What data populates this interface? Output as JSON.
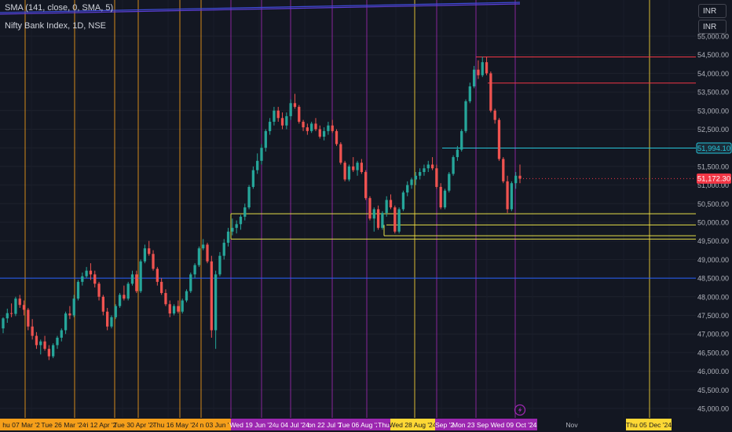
{
  "header": {
    "indicator": "SMA (141, close, 0, SMA, 5)",
    "symbol": "Nifty Bank Index, 1D, NSE"
  },
  "currency_buttons": [
    "INR",
    "INR"
  ],
  "price_labels": {
    "last_price": "51,172.30",
    "cross_line": "51,994.10"
  },
  "colors": {
    "background": "#131722",
    "bull": "#26a69a",
    "bear": "#ef5350",
    "orange_marker": "#f59f1a",
    "purple_marker": "#9c27b0",
    "yellow_marker": "#fdd835",
    "level_yellow": "#e6e04a",
    "level_red": "#f23645",
    "level_cyan": "#26c6da",
    "level_blue": "#2962ff"
  },
  "chart_data": {
    "type": "candlestick",
    "y_axis_ticks": [
      "55,000.00",
      "54,500.00",
      "54,000.00",
      "53,500.00",
      "53,000.00",
      "52,500.00",
      "52,000.00",
      "51,500.00",
      "51,000.00",
      "50,500.00",
      "50,000.00",
      "49,500.00",
      "49,000.00",
      "48,500.00",
      "48,000.00",
      "47,500.00",
      "47,000.00",
      "46,500.00",
      "46,000.00",
      "45,500.00",
      "45,000.00"
    ],
    "y_axis_values": [
      55000,
      54500,
      54000,
      53500,
      53000,
      52500,
      52000,
      51500,
      51000,
      50500,
      50000,
      49500,
      49000,
      48500,
      48000,
      47500,
      47000,
      46500,
      46000,
      45500,
      45000
    ],
    "ylim": [
      44900,
      55300
    ],
    "axis_side": "right",
    "time_labels": [
      {
        "text": "hu 07 Mar '2",
        "style": "orange"
      },
      {
        "text": "Tue 26 Mar '24",
        "style": "orange"
      },
      {
        "text": "ri 12 Apr '2",
        "style": "orange"
      },
      {
        "text": "Tue 30 Apr '24",
        "style": "orange"
      },
      {
        "text": "Thu 16 May '24",
        "style": "orange"
      },
      {
        "text": "n 03 Jun '",
        "style": "orange"
      },
      {
        "text": "Wed 19 Jun '24",
        "style": "purple"
      },
      {
        "text": "u 04 Jul '24",
        "style": "purple"
      },
      {
        "text": "on 22 Jul '2",
        "style": "purple"
      },
      {
        "text": "Tue 06 Aug '2",
        "style": "purple"
      },
      {
        "text": "Thu",
        "style": "purple"
      },
      {
        "text": "Wed 28 Aug '24",
        "style": "yellow"
      },
      {
        "text": "Sep '2",
        "style": "purple"
      },
      {
        "text": "Mon 23 Sep '",
        "style": "purple"
      },
      {
        "text": "Wed 09 Oct '24",
        "style": "purple"
      },
      {
        "text": "Nov",
        "style": "plain"
      },
      {
        "text": "Thu 05 Dec '24",
        "style": "yellow"
      }
    ],
    "vertical_markers": [
      {
        "color": "orange"
      },
      {
        "color": "orange"
      },
      {
        "color": "orange"
      },
      {
        "color": "orange"
      },
      {
        "color": "orange"
      },
      {
        "color": "orange"
      },
      {
        "color": "purple"
      },
      {
        "color": "purple"
      },
      {
        "color": "purple"
      },
      {
        "color": "purple"
      },
      {
        "color": "purple"
      },
      {
        "color": "yellow"
      },
      {
        "color": "purple"
      },
      {
        "color": "purple"
      },
      {
        "color": "purple"
      },
      {
        "color": "yellow"
      }
    ],
    "horizontal_levels": [
      {
        "price": 54440,
        "color": "red"
      },
      {
        "price": 53740,
        "color": "red"
      },
      {
        "price": 51994,
        "color": "cyan"
      },
      {
        "price": 50230,
        "color": "yellow"
      },
      {
        "price": 49930,
        "color": "yellow"
      },
      {
        "price": 49640,
        "color": "yellow"
      },
      {
        "price": 49550,
        "color": "yellow"
      },
      {
        "price": 48500,
        "color": "blue"
      }
    ],
    "last_price": 51172.3,
    "cross_line_price": 51994.1,
    "candles": [
      [
        47150,
        47450,
        47020,
        47420
      ],
      [
        47420,
        47680,
        47300,
        47560
      ],
      [
        47560,
        47820,
        47450,
        47540
      ],
      [
        47540,
        48000,
        47480,
        47950
      ],
      [
        47950,
        48050,
        47700,
        47780
      ],
      [
        47780,
        47900,
        47500,
        47650
      ],
      [
        47650,
        47700,
        47100,
        47200
      ],
      [
        47200,
        47400,
        46850,
        46950
      ],
      [
        46950,
        47050,
        46600,
        46700
      ],
      [
        46700,
        46850,
        46450,
        46800
      ],
      [
        46800,
        46950,
        46550,
        46600
      ],
      [
        46600,
        46700,
        46300,
        46400
      ],
      [
        46400,
        46750,
        46350,
        46700
      ],
      [
        46700,
        46950,
        46600,
        46900
      ],
      [
        46900,
        47150,
        46800,
        47100
      ],
      [
        47100,
        47600,
        47000,
        47550
      ],
      [
        47550,
        47750,
        47400,
        47500
      ],
      [
        47500,
        48050,
        47450,
        47950
      ],
      [
        47950,
        48450,
        47900,
        48400
      ],
      [
        48400,
        48650,
        48300,
        48550
      ],
      [
        48550,
        48800,
        48500,
        48700
      ],
      [
        48700,
        48900,
        48450,
        48600
      ],
      [
        48600,
        48700,
        48250,
        48350
      ],
      [
        48350,
        48400,
        47900,
        48000
      ],
      [
        48000,
        48050,
        47500,
        47600
      ],
      [
        47600,
        47700,
        47100,
        47200
      ],
      [
        47200,
        47500,
        47150,
        47450
      ],
      [
        47450,
        47800,
        47400,
        47750
      ],
      [
        47750,
        48100,
        47700,
        48050
      ],
      [
        48050,
        48300,
        47900,
        47950
      ],
      [
        47950,
        48400,
        47900,
        48350
      ],
      [
        48350,
        48700,
        48300,
        48600
      ],
      [
        48600,
        48700,
        48100,
        48150
      ],
      [
        48150,
        49000,
        48100,
        48950
      ],
      [
        48950,
        49400,
        48900,
        49300
      ],
      [
        49300,
        49500,
        49100,
        49150
      ],
      [
        49150,
        49250,
        48700,
        48750
      ],
      [
        48750,
        48800,
        48300,
        48400
      ],
      [
        48400,
        48500,
        48050,
        48100
      ],
      [
        48100,
        48200,
        47750,
        47800
      ],
      [
        47800,
        47900,
        47450,
        47550
      ],
      [
        47550,
        47800,
        47500,
        47750
      ],
      [
        47750,
        47900,
        47550,
        47600
      ],
      [
        47600,
        47950,
        47550,
        47900
      ],
      [
        47900,
        48200,
        47850,
        48150
      ],
      [
        48150,
        48650,
        48100,
        48600
      ],
      [
        48600,
        48900,
        48500,
        48850
      ],
      [
        48850,
        49350,
        48800,
        49300
      ],
      [
        49300,
        49550,
        49250,
        49400
      ],
      [
        49400,
        49450,
        48900,
        48950
      ],
      [
        48950,
        49100,
        46900,
        47100
      ],
      [
        47100,
        48700,
        46600,
        48600
      ],
      [
        48600,
        49200,
        48550,
        49100
      ],
      [
        49100,
        49550,
        49000,
        49450
      ],
      [
        49450,
        49850,
        49350,
        49750
      ],
      [
        49750,
        50100,
        49650,
        49850
      ],
      [
        49850,
        50050,
        49700,
        49950
      ],
      [
        49950,
        50200,
        49800,
        50150
      ],
      [
        50150,
        50500,
        50050,
        50400
      ],
      [
        50400,
        51000,
        50350,
        50950
      ],
      [
        50950,
        51500,
        50900,
        51400
      ],
      [
        51400,
        51850,
        51300,
        51650
      ],
      [
        51650,
        52100,
        51550,
        52000
      ],
      [
        52000,
        52500,
        51900,
        52450
      ],
      [
        52450,
        52800,
        52350,
        52700
      ],
      [
        52700,
        53100,
        52600,
        53000
      ],
      [
        53000,
        53100,
        52700,
        52800
      ],
      [
        52800,
        52950,
        52500,
        52600
      ],
      [
        52600,
        52950,
        52500,
        52850
      ],
      [
        52850,
        53300,
        52750,
        53200
      ],
      [
        53200,
        53450,
        53050,
        53100
      ],
      [
        53100,
        53150,
        52650,
        52700
      ],
      [
        52700,
        52750,
        52450,
        52550
      ],
      [
        52550,
        52650,
        52350,
        52450
      ],
      [
        52450,
        52700,
        52400,
        52650
      ],
      [
        52650,
        52800,
        52450,
        52500
      ],
      [
        52500,
        52600,
        52250,
        52300
      ],
      [
        52300,
        52550,
        52200,
        52450
      ],
      [
        52450,
        52700,
        52350,
        52600
      ],
      [
        52600,
        52750,
        52400,
        52450
      ],
      [
        52450,
        52500,
        52050,
        52100
      ],
      [
        52100,
        52150,
        51550,
        51600
      ],
      [
        51600,
        51650,
        51100,
        51150
      ],
      [
        51150,
        51550,
        51100,
        51500
      ],
      [
        51500,
        51750,
        51350,
        51400
      ],
      [
        51400,
        51650,
        51250,
        51600
      ],
      [
        51600,
        51700,
        51300,
        51350
      ],
      [
        51350,
        51400,
        50600,
        50650
      ],
      [
        50650,
        50700,
        50050,
        50100
      ],
      [
        50100,
        50400,
        49750,
        50350
      ],
      [
        50350,
        50450,
        49800,
        49850
      ],
      [
        49850,
        50300,
        49800,
        50250
      ],
      [
        50250,
        50700,
        50150,
        50600
      ],
      [
        50600,
        50750,
        50350,
        50400
      ],
      [
        50400,
        50450,
        49700,
        49750
      ],
      [
        49750,
        50400,
        49700,
        50350
      ],
      [
        50350,
        50850,
        50300,
        50800
      ],
      [
        50800,
        51100,
        50700,
        51000
      ],
      [
        51000,
        51200,
        50900,
        51150
      ],
      [
        51150,
        51350,
        51000,
        51250
      ],
      [
        51250,
        51450,
        51150,
        51350
      ],
      [
        51350,
        51550,
        51250,
        51450
      ],
      [
        51450,
        51650,
        51350,
        51550
      ],
      [
        51550,
        51750,
        51400,
        51450
      ],
      [
        51450,
        51550,
        50900,
        50950
      ],
      [
        50950,
        51050,
        50350,
        50400
      ],
      [
        50400,
        50900,
        50350,
        50850
      ],
      [
        50850,
        51350,
        50800,
        51300
      ],
      [
        51300,
        51800,
        51250,
        51750
      ],
      [
        51750,
        52050,
        51650,
        51950
      ],
      [
        51950,
        52500,
        51900,
        52450
      ],
      [
        52450,
        53300,
        52400,
        53250
      ],
      [
        53250,
        53750,
        53200,
        53650
      ],
      [
        53650,
        54200,
        53600,
        54100
      ],
      [
        54100,
        54350,
        53850,
        53950
      ],
      [
        53950,
        54450,
        53900,
        54300
      ],
      [
        54300,
        54450,
        53950,
        54000
      ],
      [
        54000,
        54050,
        52950,
        53000
      ],
      [
        53000,
        53050,
        52650,
        52750
      ],
      [
        52750,
        52800,
        51650,
        51700
      ],
      [
        51700,
        51750,
        51050,
        51100
      ],
      [
        51100,
        51250,
        50250,
        50350
      ],
      [
        50350,
        51100,
        50300,
        51050
      ],
      [
        51050,
        51350,
        50900,
        51250
      ],
      [
        51250,
        51550,
        51050,
        51172.3
      ]
    ]
  }
}
